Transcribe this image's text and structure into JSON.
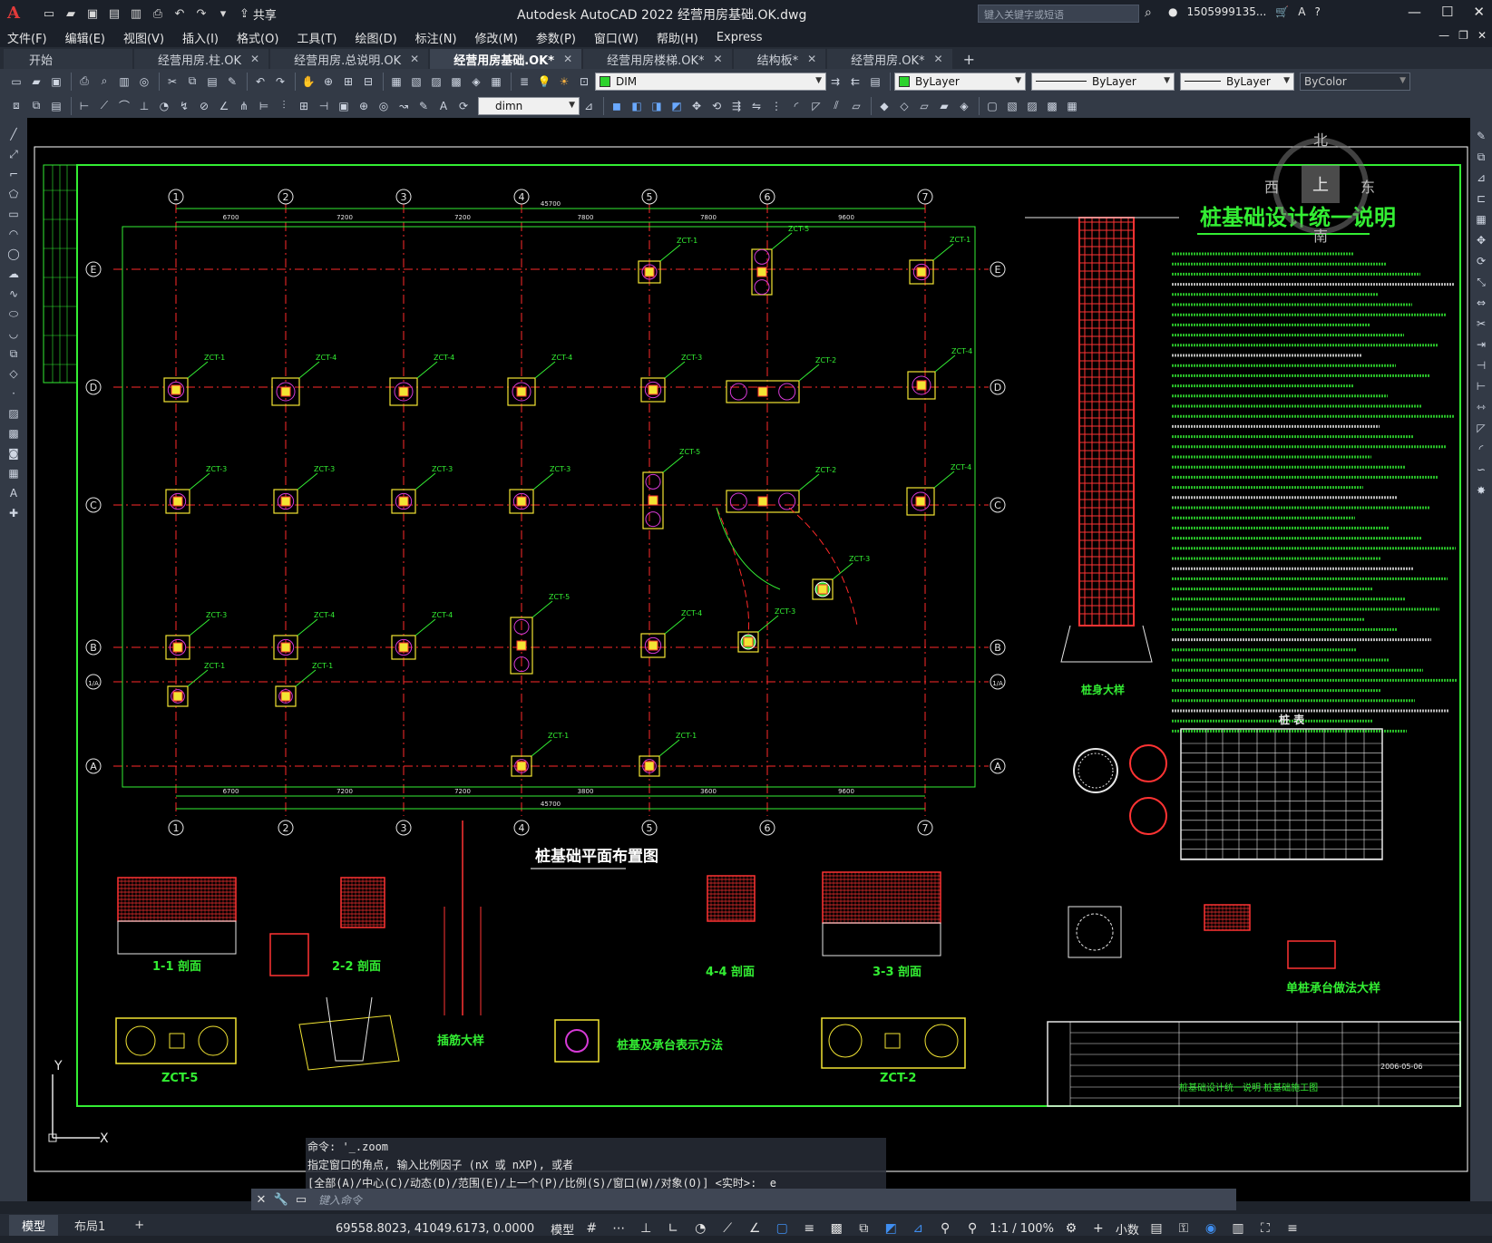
{
  "titlebar": {
    "title": "Autodesk AutoCAD 2022    经营用房基础.OK.dwg",
    "share": "共享",
    "search_placeholder": "键入关键字或短语",
    "user": "1505999135...",
    "window_controls": [
      "minimize",
      "maximize",
      "close"
    ]
  },
  "menu": [
    "文件(F)",
    "编辑(E)",
    "视图(V)",
    "插入(I)",
    "格式(O)",
    "工具(T)",
    "绘图(D)",
    "标注(N)",
    "修改(M)",
    "参数(P)",
    "窗口(W)",
    "帮助(H)",
    "Express"
  ],
  "tabs": [
    {
      "label": "开始",
      "active": false
    },
    {
      "label": "经营用房.柱.OK",
      "active": false
    },
    {
      "label": "经营用房.总说明.OK",
      "active": false
    },
    {
      "label": "经营用房基础.OK*",
      "active": true
    },
    {
      "label": "经营用房楼梯.OK*",
      "active": false
    },
    {
      "label": "结构板*",
      "active": false
    },
    {
      "label": "经营用房.OK*",
      "active": false
    }
  ],
  "toolbar": {
    "layer": "DIM",
    "color": "ByLayer",
    "linetype": "ByLayer",
    "lineweight": "ByLayer",
    "plotstyle": "ByColor",
    "dimstyle": "dimn"
  },
  "viewcube": {
    "north": "北",
    "south": "南",
    "east": "东",
    "west": "西",
    "top": "上"
  },
  "drawing": {
    "axis_labels_x": [
      "1",
      "2",
      "3",
      "4",
      "5",
      "6",
      "7"
    ],
    "axis_labels_y": [
      "E",
      "D",
      "C",
      "B",
      "1/A",
      "A"
    ],
    "top_dims": [
      "6700",
      "7200",
      "7200",
      "7800",
      "7800",
      "9600"
    ],
    "bottom_dims": [
      "6700",
      "7200",
      "7200",
      "3800",
      "3600",
      "9600"
    ],
    "total_dim": "45700",
    "plan_title": "桩基础平面布置图",
    "notes_title": "桩基础设计统一说明",
    "pile_table_title": "桩 表",
    "detail_titles": [
      "1-1 剖面",
      "2-2 剖面",
      "插筋大样",
      "4-4 剖面",
      "3-3 剖面",
      "ZCT-5",
      "ZCT-2",
      "桩基及承台表示方法",
      "单桩承台做法大样",
      "桩身大样"
    ],
    "cap_labels": [
      "ZCT-1",
      "ZCT-2",
      "ZCT-3",
      "ZCT-4",
      "ZCT-5"
    ],
    "titleblock": {
      "drawing_name": "桩基础设计统一说明   桩基础施工图",
      "date": "2006-05-06"
    }
  },
  "command": {
    "history": [
      "命令: '_.zoom",
      "指定窗口的角点, 输入比例因子 (nX 或 nXP), 或者",
      "[全部(A)/中心(C)/动态(D)/范围(E)/上一个(P)/比例(S)/窗口(W)/对象(O)] <实时>: _e"
    ],
    "placeholder": "键入命令"
  },
  "layout_tabs": [
    "模型",
    "布局1"
  ],
  "status": {
    "coords": "69558.8023, 41049.6173, 0.0000",
    "model": "模型",
    "scale": "1:1 / 100%",
    "units": "小数"
  }
}
